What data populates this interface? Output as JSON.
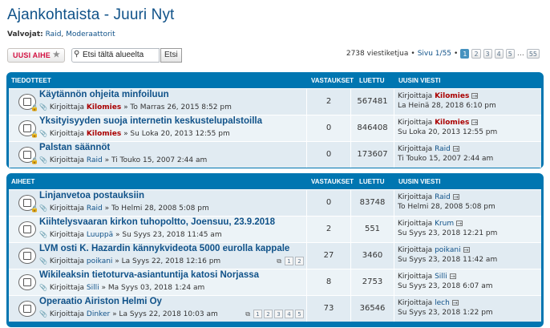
{
  "forum": {
    "title": "Ajankohtaista - Juuri Nyt",
    "moderators_label": "Valvojat:",
    "moderators": [
      "Raid",
      "Moderaattorit"
    ]
  },
  "actions": {
    "new_topic": "UUSI AIHE",
    "search_placeholder": "Etsi tältä alueelta",
    "search_button": "Etsi"
  },
  "pagination": {
    "topics_count": "2738 viestiketjua",
    "page_info": "Sivu 1/55",
    "pages": [
      "1",
      "2",
      "3",
      "4",
      "5"
    ],
    "dots": "…",
    "last": "55"
  },
  "headers": {
    "announcements": "TIEDOTTEET",
    "topics": "AIHEET",
    "replies": "VASTAUKSET",
    "views": "LUETTU",
    "last_post": "UUSIN VIESTI"
  },
  "announcements": [
    {
      "title": "Käytännön ohjeita minfoiluun",
      "by": "Kirjoittaja",
      "author": "Kilomies",
      "date": "» To Marras 26, 2015 8:52 pm",
      "replies": "2",
      "views": "567481",
      "last_by": "Kirjoittaja",
      "last_author": "Kilomies",
      "last_date": "La Heinä 28, 2018 6:10 pm"
    },
    {
      "title": "Yksityisyyden suoja internetin keskustelupalstoilla",
      "by": "Kirjoittaja",
      "author": "Kilomies",
      "date": "» Su Loka 20, 2013 12:55 pm",
      "replies": "0",
      "views": "846408",
      "last_by": "Kirjoittaja",
      "last_author": "Kilomies",
      "last_date": "Su Loka 20, 2013 12:55 pm"
    },
    {
      "title": "Palstan säännöt",
      "by": "Kirjoittaja",
      "author": "Raid",
      "date": "» Ti Touko 15, 2007 2:44 am",
      "replies": "0",
      "views": "173607",
      "last_by": "Kirjoittaja",
      "last_author": "Raid",
      "last_date": "Ti Touko 15, 2007 2:44 am"
    }
  ],
  "topics": [
    {
      "title": "Linjanvetoa postauksiin",
      "by": "Kirjoittaja",
      "author": "Raid",
      "date": "» To Helmi 28, 2008 5:08 pm",
      "replies": "0",
      "views": "83748",
      "last_by": "Kirjoittaja",
      "last_author": "Raid",
      "last_date": "To Helmi 28, 2008 5:08 pm",
      "pages": []
    },
    {
      "title": "Kiihtelysvaaran kirkon tuhopoltto, Joensuu, 23.9.2018",
      "by": "Kirjoittaja",
      "author": "Luuppä",
      "date": "» Su Syys 23, 2018 11:45 am",
      "replies": "2",
      "views": "551",
      "last_by": "Kirjoittaja",
      "last_author": "Krum",
      "last_date": "Su Syys 23, 2018 12:21 pm",
      "pages": []
    },
    {
      "title": "LVM osti K. Hazardin kännykvideota 5000 eurolla kappale",
      "by": "Kirjoittaja",
      "author": "poikani",
      "date": "» La Syys 22, 2018 12:16 pm",
      "replies": "27",
      "views": "3460",
      "last_by": "Kirjoittaja",
      "last_author": "poikani",
      "last_date": "Su Syys 23, 2018 11:42 am",
      "pages": [
        "1",
        "2"
      ]
    },
    {
      "title": "Wikileaksin tietoturva-asiantuntija katosi Norjassa",
      "by": "Kirjoittaja",
      "author": "Silli",
      "date": "» Ma Syys 03, 2018 1:24 am",
      "replies": "8",
      "views": "2753",
      "last_by": "Kirjoittaja",
      "last_author": "Silli",
      "last_date": "Su Syys 23, 2018 6:07 am",
      "pages": []
    },
    {
      "title": "Operaatio Airiston Helmi Oy",
      "by": "Kirjoittaja",
      "author": "Dinker",
      "date": "» La Syys 22, 2018 10:03 am",
      "replies": "73",
      "views": "36546",
      "last_by": "Kirjoittaja",
      "last_author": "lech",
      "last_date": "Su Syys 23, 2018 1:22 pm",
      "pages": [
        "1",
        "2",
        "3",
        "4",
        "5"
      ]
    }
  ]
}
